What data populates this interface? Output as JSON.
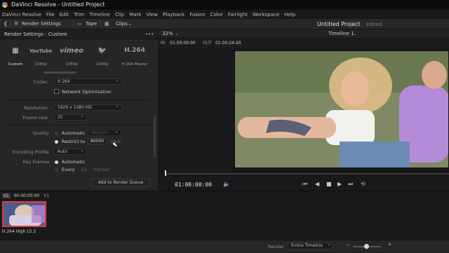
{
  "window": {
    "title": "DaVinci Resolve - Untitled Project"
  },
  "menu": [
    "DaVinci Resolve",
    "File",
    "Edit",
    "Trim",
    "Timeline",
    "Clip",
    "Mark",
    "View",
    "Playback",
    "Fusion",
    "Color",
    "Fairlight",
    "Workspace",
    "Help"
  ],
  "toolbar": {
    "render_settings": "Render Settings",
    "tape": "Tape",
    "clips": "Clips",
    "project_name": "Untitled Project",
    "edited": "Edited"
  },
  "render_panel": {
    "title": "Render Settings - Custom",
    "more": "•••",
    "presets": [
      {
        "icon": "film-strip-icon",
        "label": "Custom",
        "brand": ""
      },
      {
        "icon": "youtube-logo",
        "label": "1080p",
        "brand": "YouTube"
      },
      {
        "icon": "vimeo-logo",
        "label": "1080p",
        "brand": "vimeo"
      },
      {
        "icon": "twitter-logo",
        "label": "1080p",
        "brand": "🐦"
      },
      {
        "icon": "h264-logo",
        "label": "H.264 Master",
        "brand": "H.264"
      }
    ],
    "codec": {
      "label": "Codec",
      "value": "H.264"
    },
    "network_optimization": "Network Optimization",
    "resolution": {
      "label": "Resolution",
      "value": "1920 x 1080 HD"
    },
    "frame_rate": {
      "label": "Frame rate",
      "value": "25"
    },
    "quality": {
      "label": "Quality",
      "automatic": "Automatic",
      "automatic_value": "Medium",
      "restrict_to": "Restrict to",
      "restrict_value": "80000",
      "unit": "Kb/s"
    },
    "encoding_profile": {
      "label": "Encoding Profile",
      "value": "Auto"
    },
    "key_frames": {
      "label": "Key Frames",
      "automatic": "Automatic",
      "every": "Every",
      "every_value": "12",
      "frames": "frames"
    },
    "add_to_queue": "Add to Render Queue"
  },
  "viewer": {
    "zoom": "32%",
    "timeline_name": "Timeline 1",
    "in_label": "IN",
    "in_tc": "01:00:00:00",
    "out_label": "OUT",
    "out_tc": "01:00:24:20",
    "playhead_tc": "01:00:00:00"
  },
  "timeline": {
    "track_index": "01",
    "clip_tc": "00:00:00:00",
    "track": "V1",
    "clip_name": "H.264 High L5.2"
  },
  "status": {
    "render_label": "Render",
    "render_value": "Entire Timeline"
  },
  "colors": {
    "accent_red": "#e23a3a",
    "background": "#1e1e20"
  }
}
